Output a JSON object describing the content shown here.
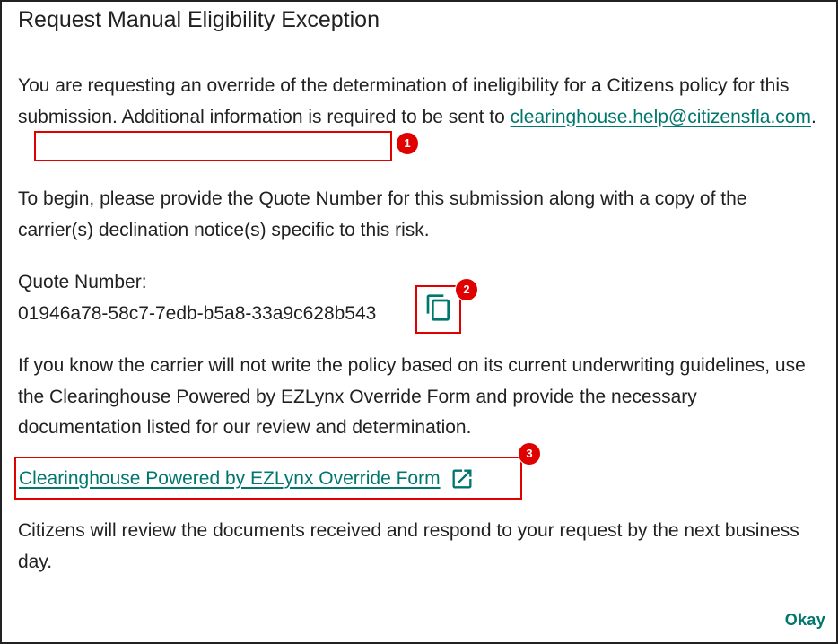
{
  "dialog": {
    "title": "Request Manual Eligibility Exception",
    "intro_text": "You are requesting an override of the determination of ineligibility for a Citizens policy for this submission. Additional information is required to be sent to ",
    "email_link": "clearinghouse.help@citizensfla.com",
    "intro_end": ".",
    "begin_text": "To begin, please provide the Quote Number for this submission along with a copy of the carrier(s) declination notice(s) specific to this risk.",
    "quote_label": "Quote Number:",
    "quote_number": "01946a78-58c7-7edb-b5a8-33a9c628b543",
    "carrier_text": "If you know the carrier will not write the policy based on its current underwriting guidelines, use the Clearinghouse Powered by EZLynx Override Form and provide the necessary documentation listed for our review and determination.",
    "override_link": "Clearinghouse Powered by EZLynx Override Form",
    "review_text": "Citizens will review the documents received and respond to your request by the next business day.",
    "okay_button": "Okay"
  },
  "annotations": {
    "badge_1": "1",
    "badge_2": "2",
    "badge_3": "3"
  },
  "icons": {
    "copy": "copy-icon",
    "external_link": "external-link-icon"
  },
  "colors": {
    "link": "#00776e",
    "annotation_red": "#e00000",
    "text": "#212121"
  }
}
